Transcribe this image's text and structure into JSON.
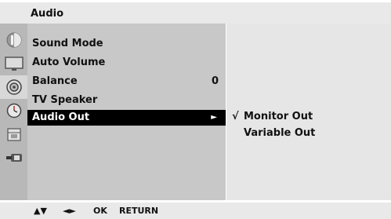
{
  "header": {
    "title": "Audio"
  },
  "sidebar": {
    "icons": [
      {
        "name": "picture-icon",
        "active": false
      },
      {
        "name": "tv-screen-icon",
        "active": false
      },
      {
        "name": "speaker-icon",
        "active": true
      },
      {
        "name": "clock-icon",
        "active": false
      },
      {
        "name": "lock-icon",
        "active": false
      },
      {
        "name": "input-icon",
        "active": false
      }
    ]
  },
  "menu": {
    "items": [
      {
        "label": "Sound Mode"
      },
      {
        "label": "Auto Volume"
      },
      {
        "label": "Balance",
        "value": "0"
      },
      {
        "label": "TV Speaker"
      },
      {
        "label": "Audio Out",
        "arrow": "►",
        "selected": true
      }
    ]
  },
  "submenu": {
    "items": [
      {
        "check": "√",
        "label": "Monitor Out"
      },
      {
        "check": "",
        "label": "Variable Out"
      }
    ]
  },
  "footer": {
    "hints": [
      "▲▼",
      "◄►",
      "OK",
      "RETURN"
    ]
  }
}
